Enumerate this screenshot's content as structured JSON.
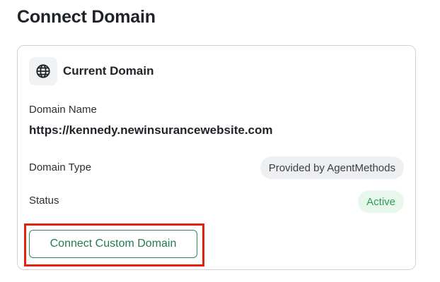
{
  "page": {
    "title": "Connect Domain"
  },
  "card": {
    "title": "Current Domain",
    "icon": "globe-icon",
    "domain_name_label": "Domain Name",
    "domain_name_value": "https://kennedy.newinsurancewebsite.com",
    "domain_type_label": "Domain Type",
    "domain_type_value": "Provided by AgentMethods",
    "status_label": "Status",
    "status_value": "Active",
    "connect_button_label": "Connect Custom Domain"
  },
  "colors": {
    "accent_green": "#237a52",
    "status_active_bg": "#e7f7ec",
    "status_active_text": "#2f9a57",
    "highlight_red": "#e0220f"
  }
}
